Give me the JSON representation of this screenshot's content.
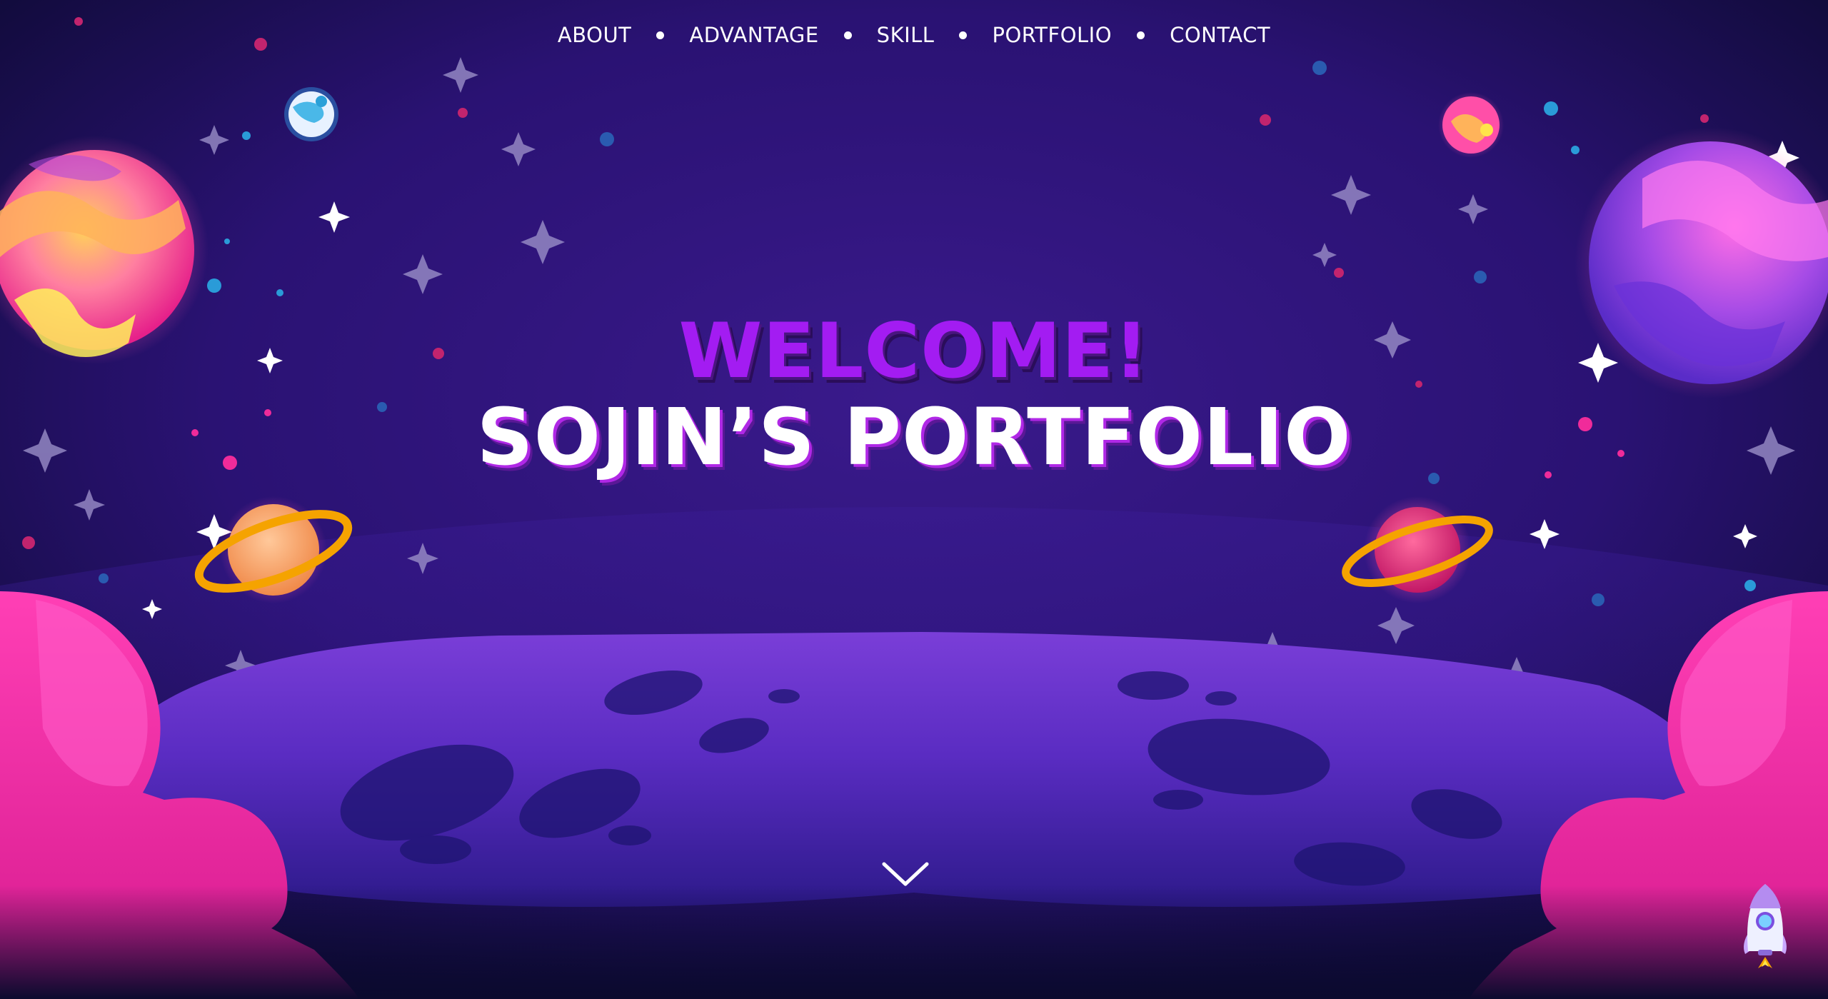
{
  "nav": {
    "items": [
      {
        "label": "ABOUT"
      },
      {
        "label": "ADVANTAGE"
      },
      {
        "label": "SKILL"
      },
      {
        "label": "PORTFOLIO"
      },
      {
        "label": "CONTACT"
      }
    ]
  },
  "hero": {
    "welcome": "WELCOME!",
    "title": "SOJIN’S PORTFOLIO"
  },
  "icons": {
    "scroll": "chevron-down-icon",
    "rocket": "rocket-icon"
  },
  "colors": {
    "background": "#0b0a2e",
    "sky": "#331680",
    "welcome": "#a31cf2",
    "title": "#ffffff",
    "title_shadow": "#b028e6",
    "moon": "#5a2cc2",
    "hills": "#ff2fa8",
    "ring": "#f5a300"
  }
}
